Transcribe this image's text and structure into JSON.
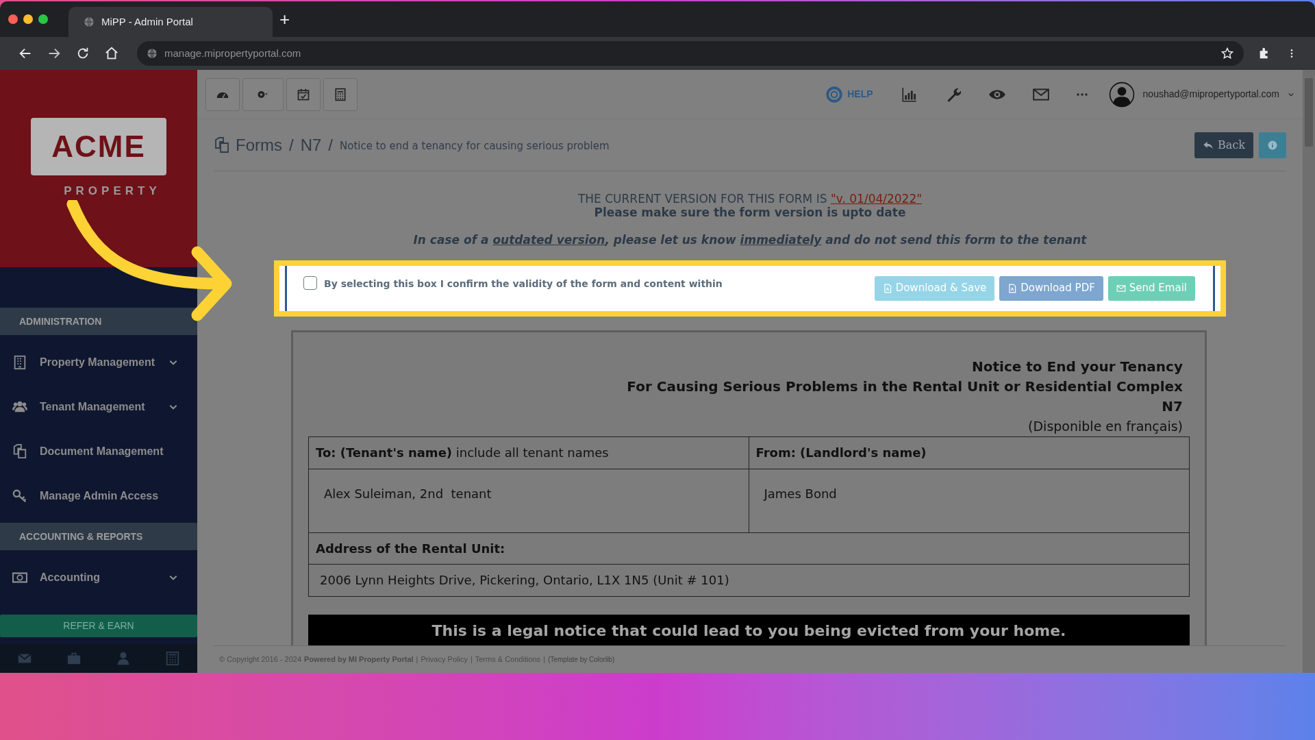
{
  "browser": {
    "tab_title": "MiPP - Admin Portal",
    "new_tab": "+",
    "url": "manage.mipropertyportal.com"
  },
  "sidebar": {
    "logo": {
      "name": "ACME",
      "tagline": "PROPERTY"
    },
    "sections": [
      {
        "heading": "ADMINISTRATION",
        "items": [
          {
            "label": "Property Management",
            "kind": "building",
            "expandable": true
          },
          {
            "label": "Tenant Management",
            "kind": "users",
            "expandable": true
          },
          {
            "label": "Document Management",
            "kind": "documents",
            "expandable": false
          },
          {
            "label": "Manage Admin Access",
            "kind": "key",
            "expandable": false
          }
        ]
      },
      {
        "heading": "ACCOUNTING & REPORTS",
        "items": [
          {
            "label": "Accounting",
            "kind": "money",
            "expandable": true
          }
        ]
      }
    ],
    "refer_button": "REFER & EARN"
  },
  "topbar": {
    "help": "HELP",
    "user": "noushad@mipropertyportal.com"
  },
  "breadcrumb": {
    "items": [
      "Forms",
      "N7"
    ],
    "separator": "/",
    "page_title": "Notice to end a tenancy for causing serious problem",
    "back": "Back"
  },
  "version_notice": {
    "prefix": "THE CURRENT VERSION FOR THIS FORM IS ",
    "version": "\"v. 01/04/2022\"",
    "hint": "Please make sure the form version is upto date",
    "warning": [
      {
        "text": "In case of a ",
        "underlined": false
      },
      {
        "text": "outdated version",
        "underlined": true
      },
      {
        "text": ", please let us know ",
        "underlined": false
      },
      {
        "text": "immediately",
        "underlined": true
      },
      {
        "text": " and do not send this form to the tenant",
        "underlined": false
      }
    ]
  },
  "confirm": {
    "checked": false,
    "label": "By selecting this box I confirm the validity of the form and content within",
    "buttons": [
      {
        "label": "Download & Save",
        "kind": "save"
      },
      {
        "label": "Download PDF",
        "kind": "pdf"
      },
      {
        "label": "Send Email",
        "kind": "email"
      }
    ]
  },
  "form": {
    "title_lines": [
      "Notice to End your Tenancy",
      "For Causing Serious Problems in the Rental Unit or Residential Complex",
      "N7"
    ],
    "language_note": "(Disponible en français)",
    "to_label": "**To: (Tenant's name)** include all tenant names",
    "from_label": "From: (Landlord's name)",
    "to_value": "Alex Suleiman, 2nd  tenant",
    "from_value": "James Bond",
    "address_label": "Address of the Rental Unit:",
    "address_value": "2006 Lynn Heights Drive, Pickering, Ontario, L1X 1N5 (Unit # 101)",
    "banner": "This is a legal notice that could lead to you being evicted from your home."
  },
  "footer": {
    "copyright": "© Copyright 2016 - 2024 ",
    "powered": "Powered by MI Property Portal",
    "separators": [
      "|",
      "|",
      "|"
    ],
    "links": [
      "Privacy Policy",
      "Terms & Conditions"
    ],
    "template": "(Template by Colorlib)"
  }
}
